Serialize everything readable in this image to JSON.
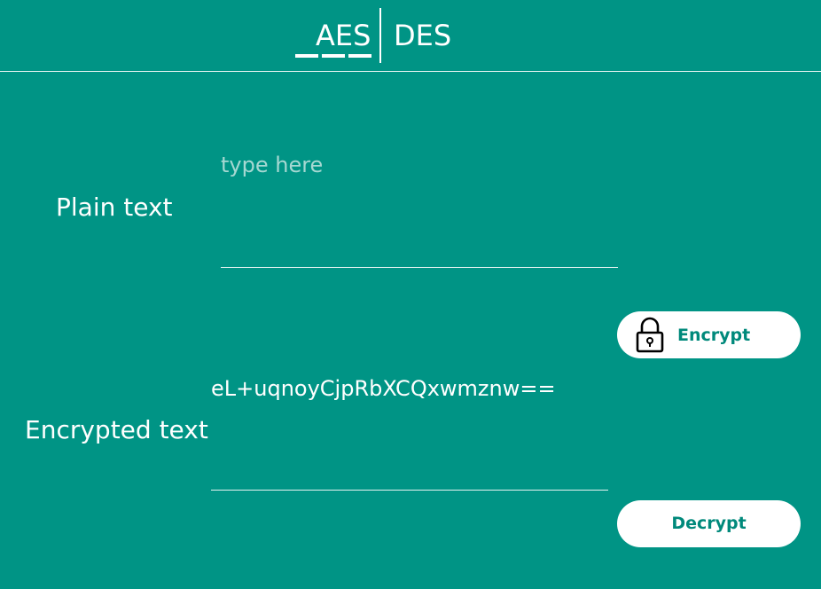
{
  "tabs": {
    "items": [
      {
        "label": "AES",
        "active": true
      },
      {
        "label": "DES",
        "active": false
      }
    ]
  },
  "plain_text": {
    "label": "Plain text",
    "placeholder": "type here",
    "value": ""
  },
  "encrypted_text": {
    "label": "Encrypted text",
    "value": "eL+uqnoyCjpRbXCQxwmznw=="
  },
  "actions": {
    "encrypt_label": "Encrypt",
    "decrypt_label": "Decrypt",
    "encrypt_icon": "lock-icon"
  },
  "colors": {
    "background": "#009485",
    "button_background": "#ffffff",
    "button_text": "#00897b",
    "foreground": "#ffffff"
  }
}
